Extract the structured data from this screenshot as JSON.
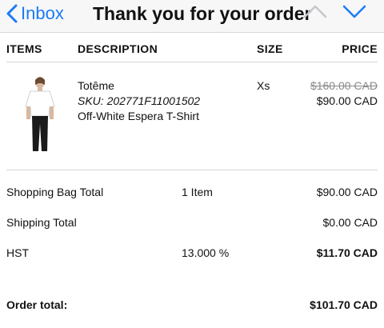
{
  "navbar": {
    "back_label": "Inbox",
    "title": "Thank you for your order",
    "up_icon": "chevron-up-icon",
    "down_icon": "chevron-down-icon",
    "accent": "#1a7cf5"
  },
  "table": {
    "headers": {
      "items": "ITEMS",
      "description": "DESCRIPTION",
      "size": "SIZE",
      "price": "PRICE"
    },
    "item": {
      "image": "product-image-white-t-shirt",
      "brand": "Totême",
      "sku": "SKU: 202771F11001502",
      "name": "Off-White Espera T-Shirt",
      "size": "Xs",
      "original_price": "$160.00 CAD",
      "sale_price": "$90.00 CAD"
    }
  },
  "summary": {
    "bag_label": "Shopping Bag Total",
    "bag_count": "1 Item",
    "bag_value": "$90.00 CAD",
    "shipping_label": "Shipping Total",
    "shipping_value": "$0.00 CAD",
    "tax_label": "HST",
    "tax_rate": "13.000 %",
    "tax_value": "$11.70 CAD",
    "order_total_label": "Order total:",
    "order_total_value": "$101.70 CAD"
  }
}
